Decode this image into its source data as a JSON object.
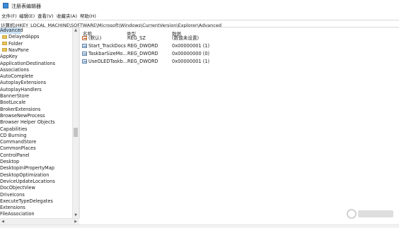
{
  "window": {
    "title": "注册表编辑器",
    "icon": "registry-editor-icon"
  },
  "menu": [
    {
      "label": "文件(F)"
    },
    {
      "label": "编辑(E)"
    },
    {
      "label": "查看(V)"
    },
    {
      "label": "收藏夹(A)"
    },
    {
      "label": "帮助(H)"
    }
  ],
  "address": "计算机\\HKEY_LOCAL_MACHINE\\SOFTWARE\\Microsoft\\Windows\\CurrentVersion\\Explorer\\Advanced",
  "tree": [
    {
      "label": "Advanced",
      "selected": true,
      "folder": false
    },
    {
      "label": "DelayedApps",
      "folder": true
    },
    {
      "label": "Folder",
      "folder": true
    },
    {
      "label": "NavPane",
      "folder": true
    },
    {
      "label": "AppKey"
    },
    {
      "label": "ApplicationDestinations"
    },
    {
      "label": "Associations"
    },
    {
      "label": "AutoComplete"
    },
    {
      "label": "AutoplayExtensions"
    },
    {
      "label": "AutoplayHandlers"
    },
    {
      "label": "BannerStore"
    },
    {
      "label": "BootLocale"
    },
    {
      "label": "BrokerExtensions"
    },
    {
      "label": "BrowseNewProcess"
    },
    {
      "label": "Browser Helper Objects"
    },
    {
      "label": "Capabilities"
    },
    {
      "label": "CD Burning"
    },
    {
      "label": "CommandStore"
    },
    {
      "label": "CommonPlaces"
    },
    {
      "label": "ControlPanel"
    },
    {
      "label": "Desktop"
    },
    {
      "label": "DesktopIniPropertyMap"
    },
    {
      "label": "DesktopOptimization"
    },
    {
      "label": "DeviceUpdateLocations"
    },
    {
      "label": "DocObjectView"
    },
    {
      "label": "DriveIcons"
    },
    {
      "label": "ExecuteTypeDelegates"
    },
    {
      "label": "Extensions"
    },
    {
      "label": "FileAssociation"
    }
  ],
  "columns": {
    "name": "名称",
    "type": "类型",
    "data": "数据"
  },
  "values": [
    {
      "name": "(默认)",
      "type": "REG_SZ",
      "data": "(数值未设置)",
      "icon": "string-value-icon"
    },
    {
      "name": "Start_TrackDocs",
      "type": "REG_DWORD",
      "data": "0x00000001 (1)",
      "icon": "dword-value-icon"
    },
    {
      "name": "TaskbarSizeMo...",
      "type": "REG_DWORD",
      "data": "0x00000000 (0)",
      "icon": "dword-value-icon"
    },
    {
      "name": "UseOLEDTaskb...",
      "type": "REG_DWORD",
      "data": "0x00000001 (1)",
      "icon": "dword-value-icon"
    }
  ],
  "colors": {
    "selection": "#cce3f7",
    "folder": "#e8c35a"
  }
}
